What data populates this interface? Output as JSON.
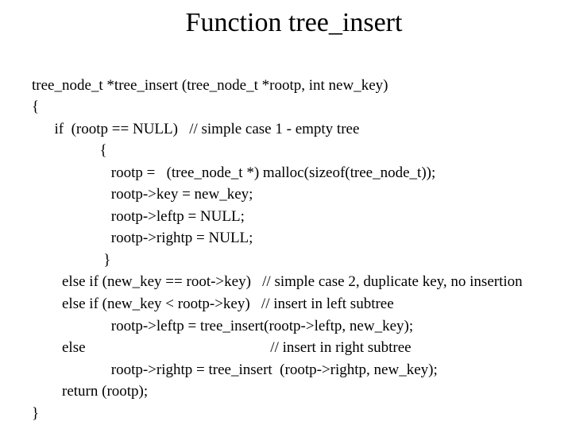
{
  "title": "Function tree_insert",
  "lines": {
    "l0": "tree_node_t *tree_insert (tree_node_t *rootp, int new_key)",
    "l1": "{",
    "l2": "      if  (rootp == NULL)   // simple case 1 - empty tree",
    "l3": "                  {",
    "l4": "                     rootp =   (tree_node_t *) malloc(sizeof(tree_node_t));",
    "l5": "                     rootp->key = new_key;",
    "l6": "                     rootp->leftp = NULL;",
    "l7": "                     rootp->rightp = NULL;",
    "l8": "                   }",
    "l9": "        else if (new_key == root->key)   // simple case 2, duplicate key, no insertion",
    "l10": "        else if (new_key < rootp->key)   // insert in left subtree",
    "l11": "                     rootp->leftp = tree_insert(rootp->leftp, new_key);",
    "l12": "        else                                                 // insert in right subtree",
    "l13": "                     rootp->rightp = tree_insert  (rootp->rightp, new_key);",
    "l14": "        return (rootp);",
    "l15": "}"
  }
}
